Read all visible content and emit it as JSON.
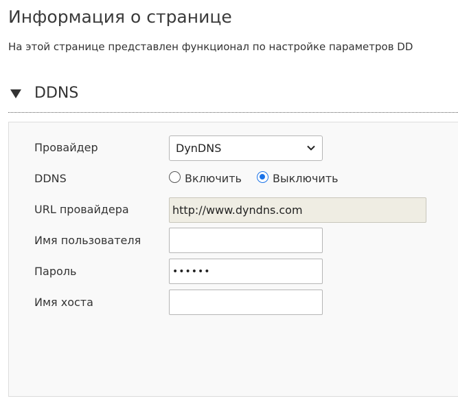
{
  "header": {
    "title": "Информация о странице",
    "description": "На этой странице представлен функционал по настройке параметров DD"
  },
  "section": {
    "title": "DDNS",
    "collapse_icon": "triangle-down-icon"
  },
  "form": {
    "provider": {
      "label": "Провайдер",
      "value": "DynDNS",
      "icon": "chevron-down-icon"
    },
    "ddns": {
      "label": "DDNS",
      "enable_label": "Включить",
      "disable_label": "Выключить",
      "selected": "disable"
    },
    "provider_url": {
      "label": "URL провайдера",
      "value": "http://www.dyndns.com"
    },
    "username": {
      "label": "Имя пользователя",
      "value": ""
    },
    "password": {
      "label": "Пароль",
      "value": "••••••"
    },
    "hostname": {
      "label": "Имя хоста",
      "value": ""
    }
  },
  "colors": {
    "radio_accent": "#1a73e8",
    "readonly_bg": "#efede3",
    "panel_bg": "#f9f9f9"
  }
}
